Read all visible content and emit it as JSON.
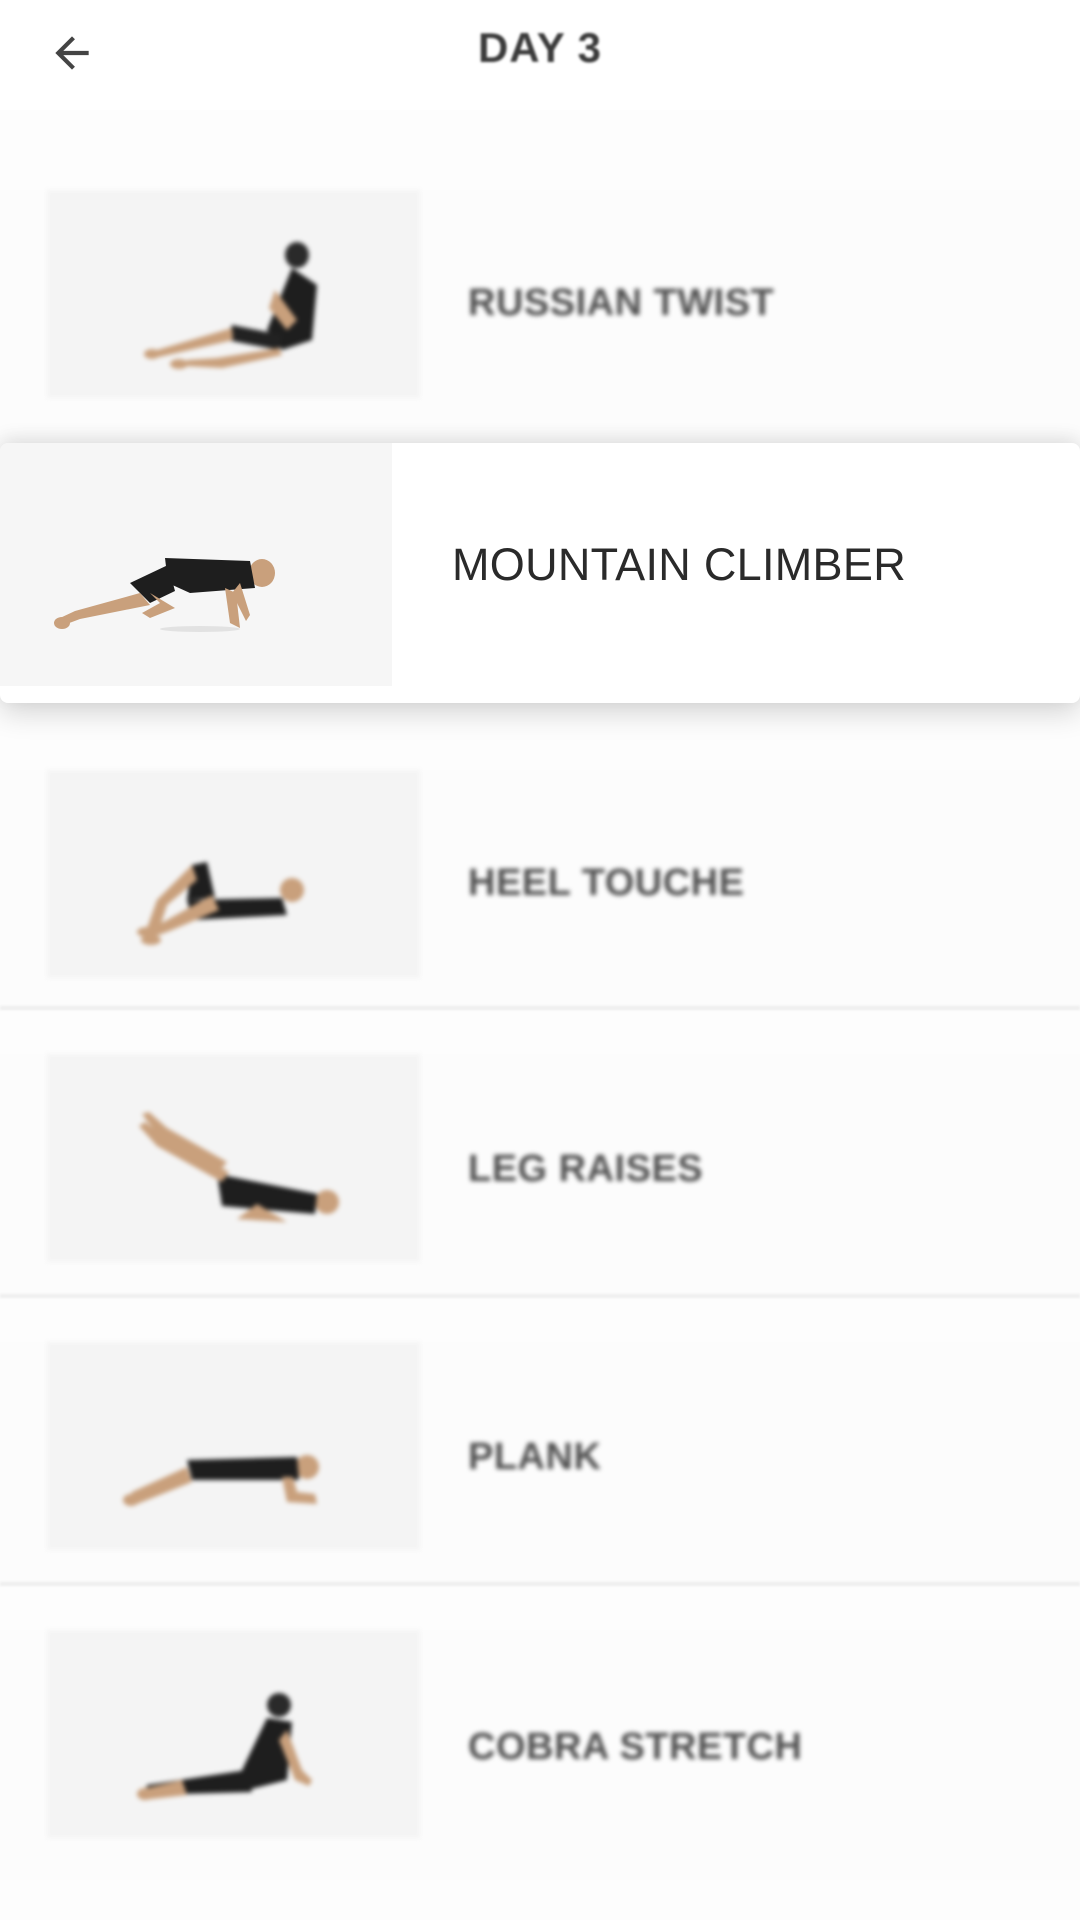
{
  "header": {
    "title": "DAY 3",
    "back_icon": "arrow-left-icon"
  },
  "exercises": [
    {
      "name": "RUSSIAN TWIST",
      "state": "blurred"
    },
    {
      "name": "MOUNTAIN CLIMBER",
      "state": "active"
    },
    {
      "name": "HEEL TOUCHE",
      "state": "blurred"
    },
    {
      "name": "LEG RAISES",
      "state": "blurred"
    },
    {
      "name": "PLANK",
      "state": "blurred"
    },
    {
      "name": "COBRA STRETCH",
      "state": "blurred"
    }
  ],
  "colors": {
    "background": "#fdfdfd",
    "card": "#ffffff",
    "text_dark": "#2a2a2a",
    "text_muted": "#505050",
    "thumb_bg": "#f4f4f4",
    "divider": "#eeeeee"
  }
}
